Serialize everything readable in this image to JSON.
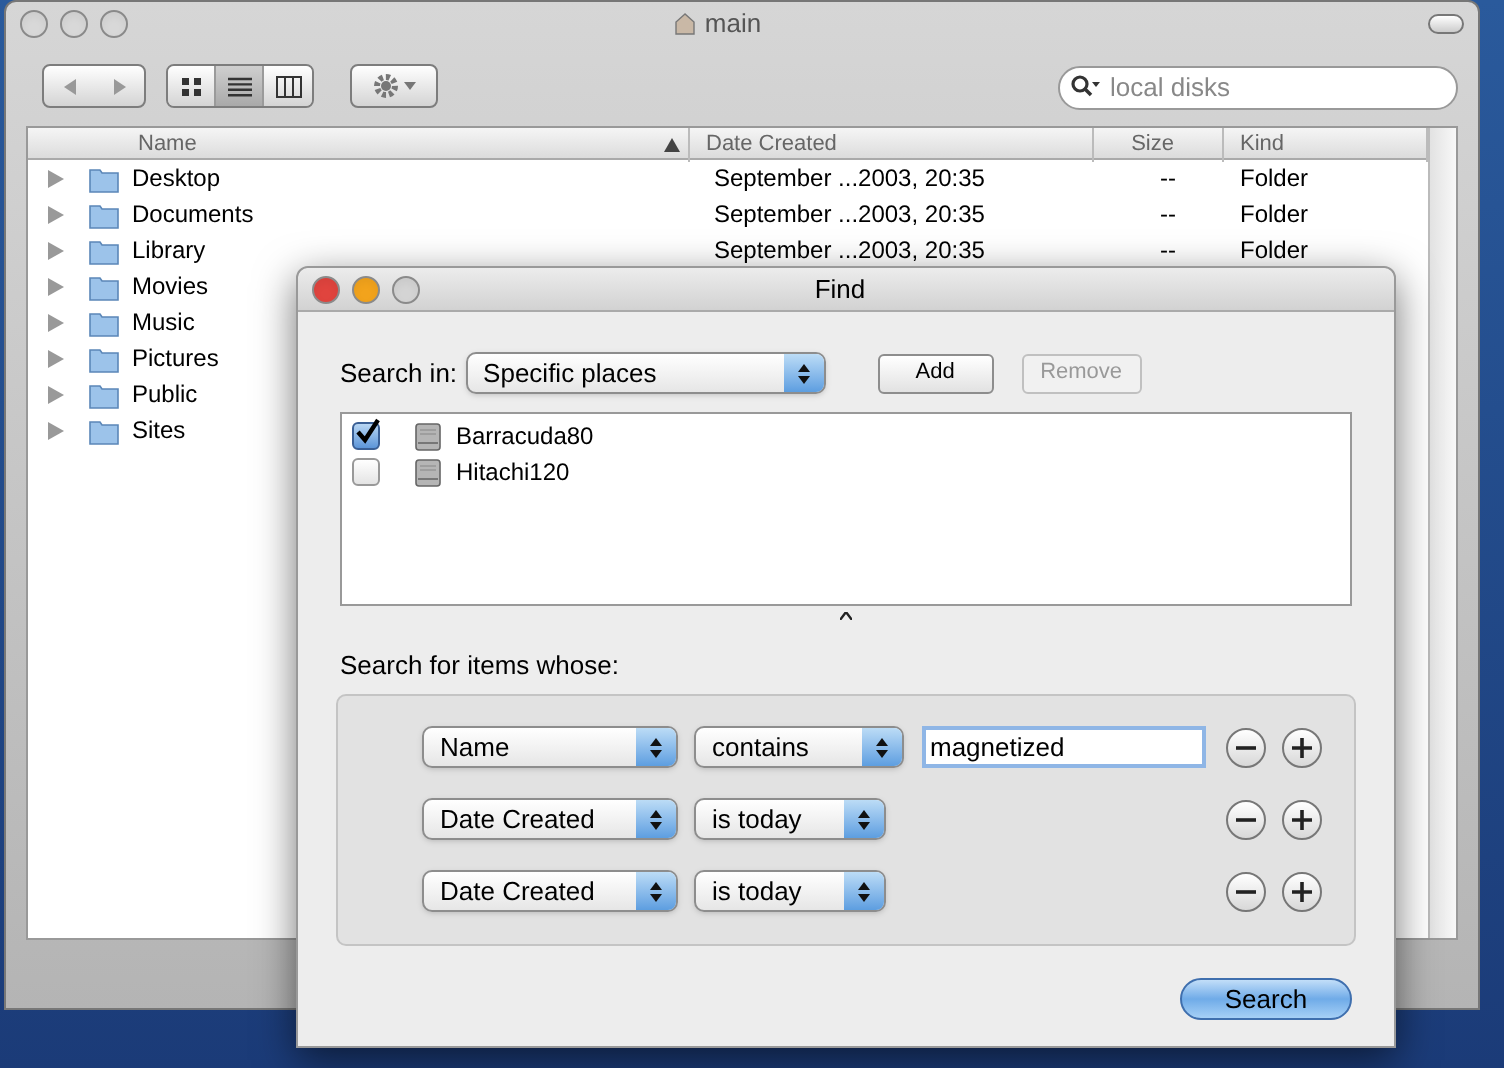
{
  "finder": {
    "title": "main",
    "search": {
      "placeholder": "local disks"
    },
    "view_modes": [
      {
        "kind": "icons",
        "selected": false
      },
      {
        "kind": "list",
        "selected": true
      },
      {
        "kind": "columns",
        "selected": false
      }
    ],
    "columns": [
      "Name",
      "Date Created",
      "Size",
      "Kind"
    ],
    "rows": [
      {
        "name": "Desktop",
        "date_created": "September ...2003, 20:35",
        "size": "--",
        "file_kind": "Folder"
      },
      {
        "name": "Documents",
        "date_created": "September ...2003, 20:35",
        "size": "--",
        "file_kind": "Folder"
      },
      {
        "name": "Library",
        "date_created": "September ...2003, 20:35",
        "size": "--",
        "file_kind": "Folder"
      },
      {
        "name": "Movies"
      },
      {
        "name": "Music"
      },
      {
        "name": "Pictures"
      },
      {
        "name": "Public"
      },
      {
        "name": "Sites"
      }
    ]
  },
  "find": {
    "title": "Find",
    "search_in_label": "Search in:",
    "search_in": "Specific places",
    "add": "Add",
    "remove": {
      "label": "Remove",
      "disabled": true
    },
    "places": [
      {
        "name": "Barracuda80",
        "checked": true
      },
      {
        "name": "Hitachi120",
        "checked": false
      }
    ],
    "criteria_label": "Search for items whose:",
    "criteria": [
      {
        "attribute": "Name",
        "operator": "contains",
        "value": "magnetized"
      },
      {
        "attribute": "Date Created",
        "operator": "is today"
      },
      {
        "attribute": "Date Created",
        "operator": "is today"
      }
    ],
    "search_button": "Search"
  }
}
